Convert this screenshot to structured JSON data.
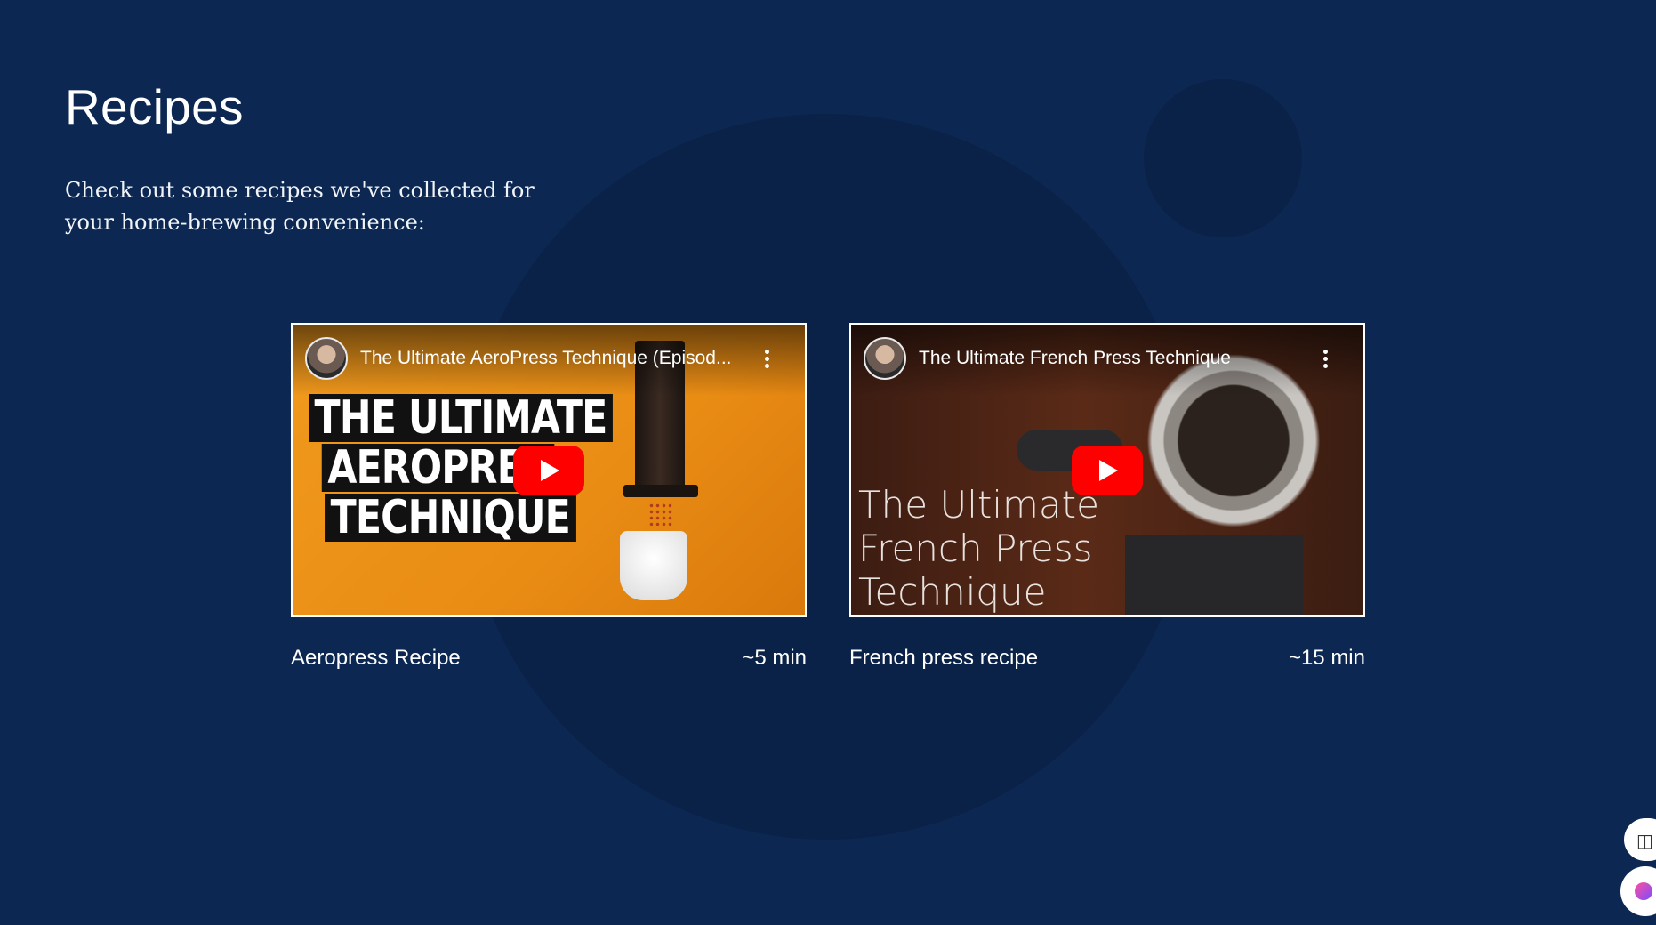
{
  "page": {
    "title": "Recipes",
    "intro": "Check out some recipes we've collected for your home-brewing convenience:"
  },
  "recipes": [
    {
      "video_title": "The Ultimate AeroPress Technique (Episod...",
      "thumbnail_text": [
        "THE ULTIMATE",
        "AEROPRES",
        "TECHNIQUE"
      ],
      "name": "Aeropress Recipe",
      "duration": "~5 min"
    },
    {
      "video_title": "The Ultimate French Press Technique",
      "thumbnail_text": [
        "The Ultimate",
        "French Press",
        "Technique"
      ],
      "name": "French press recipe",
      "duration": "~15 min"
    }
  ],
  "icons": {
    "play": "play-button-icon",
    "more": "more-vertical-icon",
    "reader": "book-icon",
    "assistant": "assistant-icon"
  },
  "colors": {
    "background": "#0b2752",
    "decor_circle": "#0a2247",
    "play_red": "#ff0000"
  }
}
